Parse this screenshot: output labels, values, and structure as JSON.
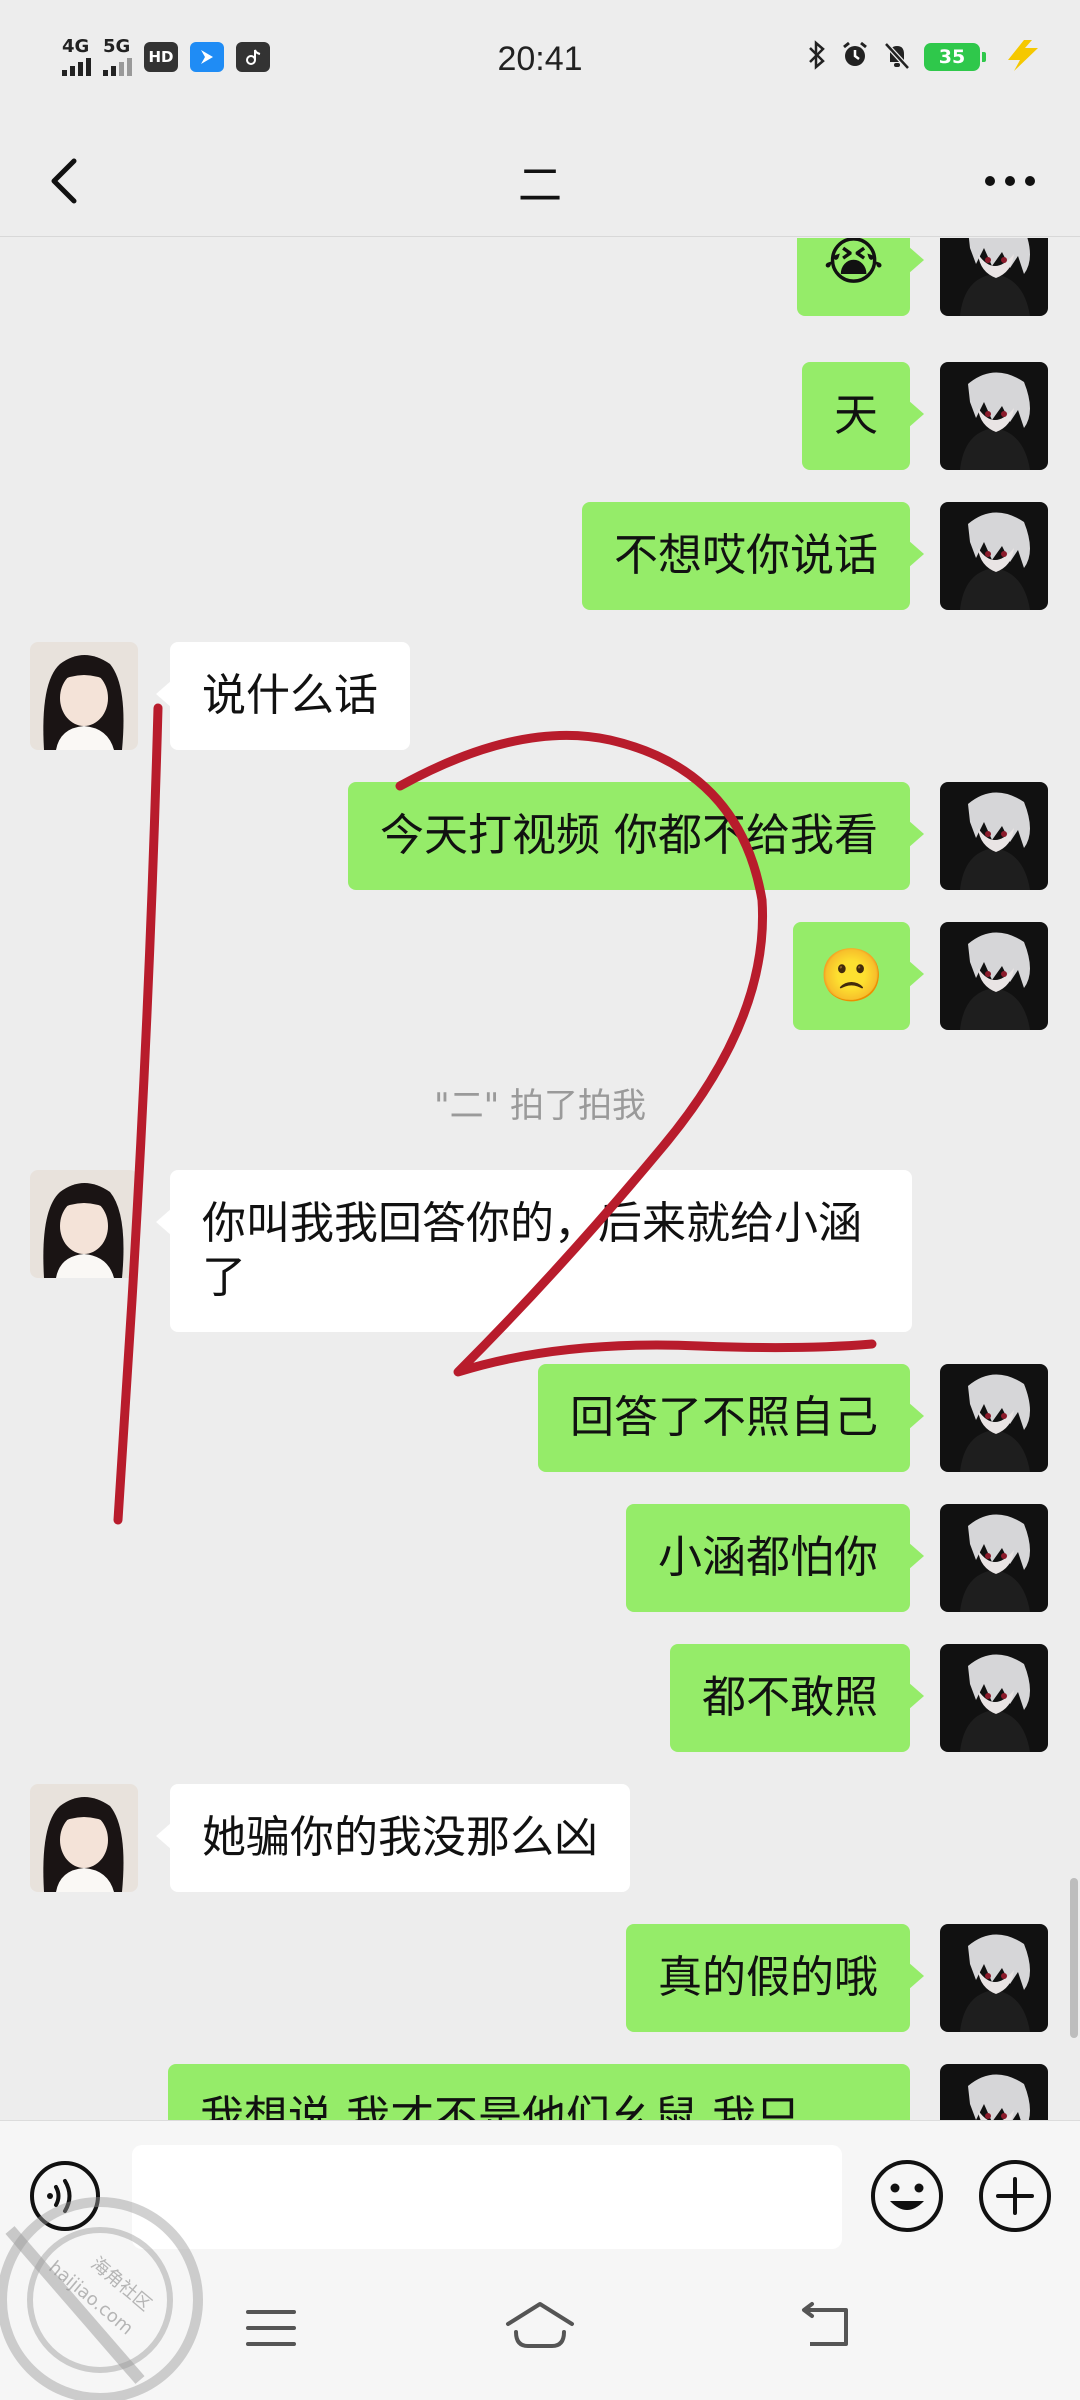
{
  "status_bar": {
    "network_1": "4G",
    "network_2": "5G",
    "hd_badge": "HD",
    "time": "20:41",
    "battery": "35"
  },
  "header": {
    "title": "二"
  },
  "messages": [
    {
      "from": "me",
      "text": "😭",
      "kind": "emoji"
    },
    {
      "from": "me",
      "text": "天"
    },
    {
      "from": "me",
      "text": "不想哎你说话"
    },
    {
      "from": "her",
      "text": "说什么话"
    },
    {
      "from": "me",
      "text": "今天打视频 你都不给我看"
    },
    {
      "from": "me",
      "text": "🙁",
      "kind": "emoji"
    },
    {
      "from": "her",
      "text": "你叫我我回答你的，后来就给小涵了"
    },
    {
      "from": "me",
      "text": "回答了不照自己"
    },
    {
      "from": "me",
      "text": "小涵都怕你"
    },
    {
      "from": "me",
      "text": "都不敢照"
    },
    {
      "from": "her",
      "text": "她骗你的我没那么凶"
    },
    {
      "from": "me",
      "text": "真的假的哦"
    },
    {
      "from": "me",
      "text": "我想说 我才不是他们幺鼠  我只"
    }
  ],
  "system_note": "\"二\" 拍了拍我",
  "input": {
    "placeholder": ""
  },
  "watermark": {
    "text_cn": "海角社区",
    "text_en": "haijiao.com"
  },
  "colors": {
    "my_bubble": "#95ec69",
    "her_bubble": "#ffffff",
    "background": "#ededed",
    "annotation": "#b81c2c"
  },
  "icons": [
    "back-icon",
    "more-icon",
    "voice-icon",
    "emoji-icon",
    "plus-icon",
    "menu-icon",
    "home-icon",
    "return-icon"
  ]
}
